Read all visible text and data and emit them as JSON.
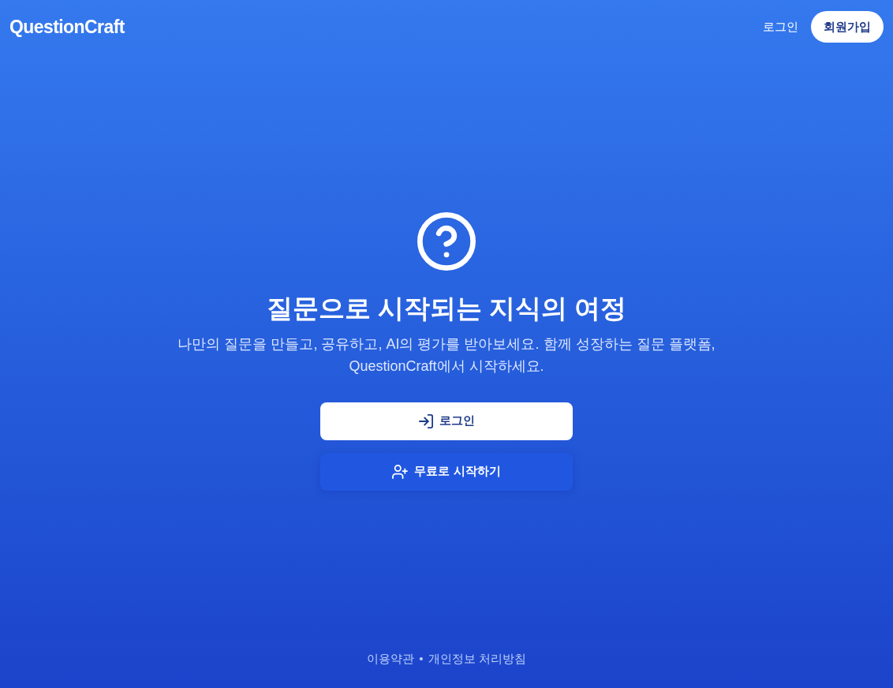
{
  "header": {
    "logo": "QuestionCraft",
    "nav": [
      {
        "label": "로그인",
        "kind": "link"
      },
      {
        "label": "회원가입",
        "kind": "button"
      }
    ]
  },
  "hero": {
    "title": "질문으로 시작되는 지식의 여정",
    "subtitle_lines": [
      "나만의 질문을 만들고, 공유하고, AI의 평가를 받아보세요. 함께 성장하는 질문 플랫폼,",
      "QuestionCraft에서 시작하세요."
    ],
    "buttons": [
      {
        "label": "로그인",
        "kind": "login"
      },
      {
        "label": "무료로 시작하기",
        "kind": "signup"
      }
    ]
  },
  "footer": {
    "links": [
      "이용약관",
      "개인정보 처리방침"
    ],
    "separator": "•"
  }
}
